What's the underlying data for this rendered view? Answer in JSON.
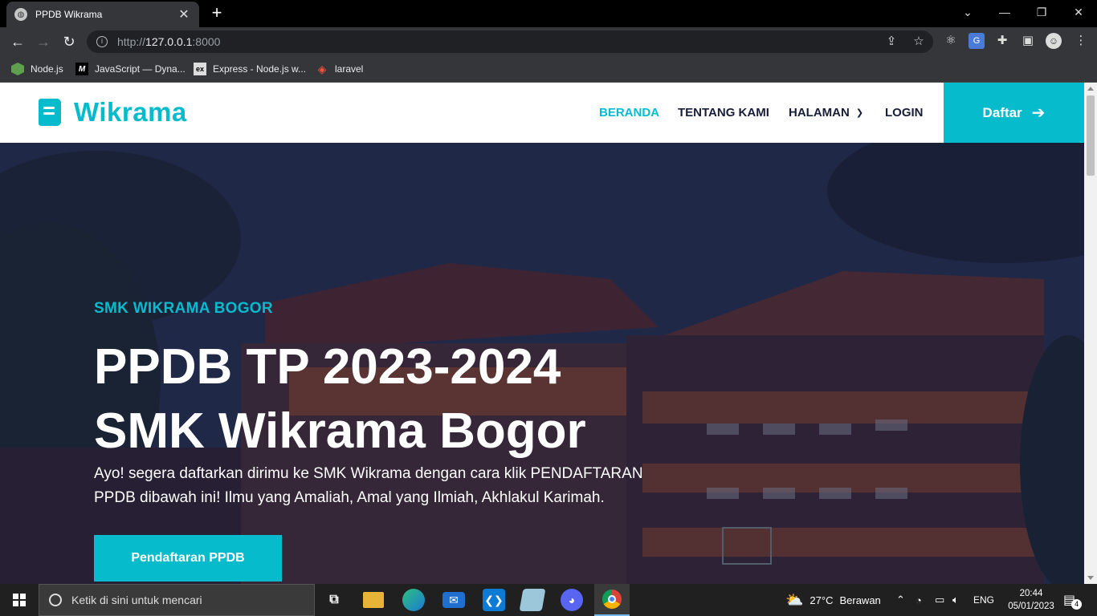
{
  "browser": {
    "tab_title": "PPDB Wikrama",
    "url_prefix": "http://",
    "url_host": "127.0.0.1",
    "url_port": ":8000",
    "bookmarks": [
      {
        "label": "Node.js",
        "icon": "nodejs-icon"
      },
      {
        "label": "JavaScript — Dyna...",
        "icon": "mdn-icon"
      },
      {
        "label": "Express - Node.js w...",
        "icon": "express-icon"
      },
      {
        "label": "laravel",
        "icon": "laravel-icon"
      }
    ]
  },
  "site": {
    "brand": "Wikrama",
    "nav": [
      {
        "label": "BERANDA",
        "active": true
      },
      {
        "label": "TENTANG KAMI",
        "active": false
      },
      {
        "label": "HALAMAN",
        "active": false
      },
      {
        "label": "LOGIN",
        "active": false
      }
    ],
    "daftar_label": "Daftar",
    "accent_color": "#06bbcc",
    "dark_color": "#181d38"
  },
  "hero": {
    "subtitle": "SMK WIKRAMA BOGOR",
    "title_line1": "PPDB TP 2023-2024",
    "title_line2": "SMK Wikrama Bogor",
    "text": "Ayo! segera daftarkan dirimu ke SMK Wikrama dengan cara klik PENDAFTARAN PPDB dibawah ini! Ilmu yang Amaliah, Amal yang Ilmiah, Akhlakul Karimah.",
    "button_label": "Pendaftaran PPDB"
  },
  "taskbar": {
    "search_placeholder": "Ketik di sini untuk mencari",
    "weather_temp": "27°C",
    "weather_text": "Berawan",
    "lang": "ENG",
    "time": "20:44",
    "date": "05/01/2023",
    "notif_count": "4"
  }
}
